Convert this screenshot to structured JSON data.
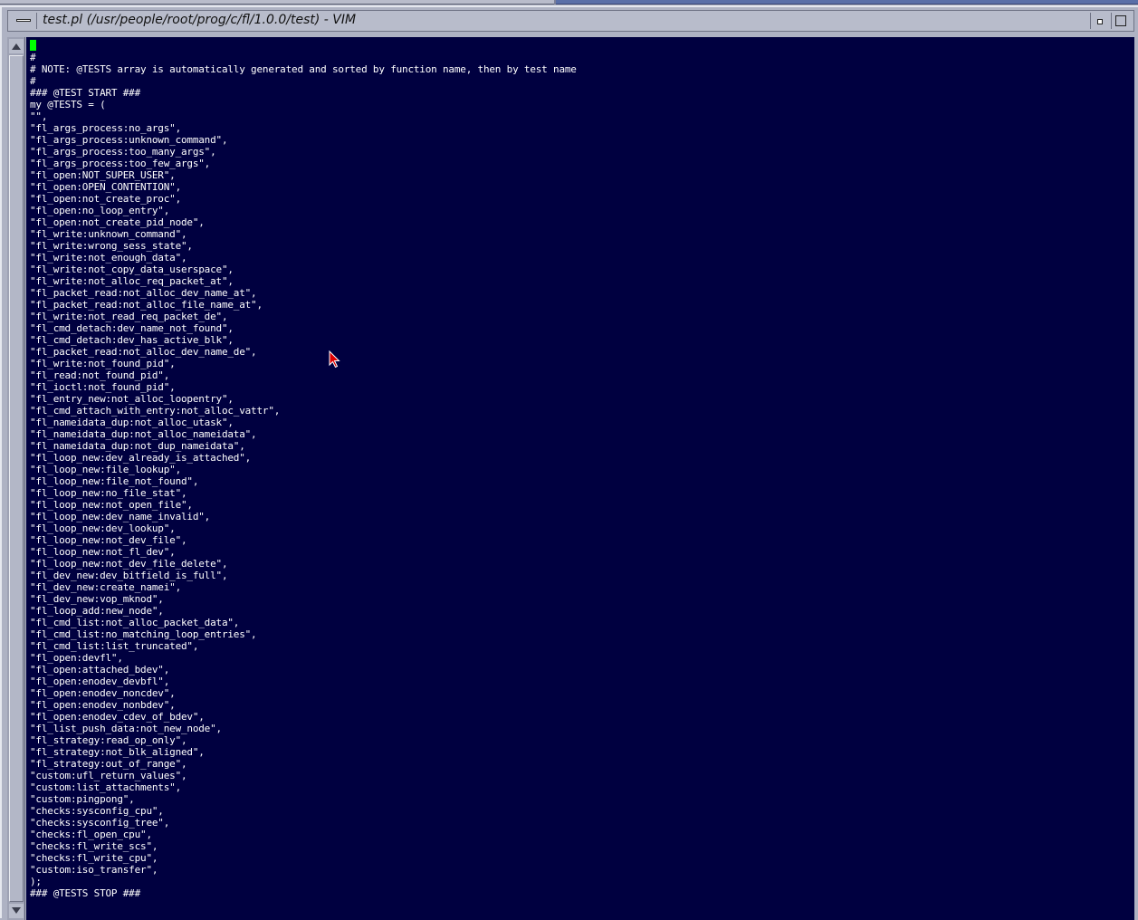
{
  "window": {
    "title": "test.pl (/usr/people/root/prog/c/fl/1.0.0/test) - VIM"
  },
  "editor": {
    "lines": [
      "",
      "#",
      "# NOTE: @TESTS array is automatically generated and sorted by function name, then by test name",
      "#",
      "### @TEST START ###",
      "my @TESTS = (",
      "\"\",",
      "\"fl_args_process:no_args\",",
      "\"fl_args_process:unknown_command\",",
      "\"fl_args_process:too_many_args\",",
      "\"fl_args_process:too_few_args\",",
      "\"fl_open:NOT_SUPER_USER\",",
      "\"fl_open:OPEN_CONTENTION\",",
      "\"fl_open:not_create_proc\",",
      "\"fl_open:no_loop_entry\",",
      "\"fl_open:not_create_pid_node\",",
      "\"fl_write:unknown_command\",",
      "\"fl_write:wrong_sess_state\",",
      "\"fl_write:not_enough_data\",",
      "\"fl_write:not_copy_data_userspace\",",
      "\"fl_write:not_alloc_req_packet_at\",",
      "\"fl_packet_read:not_alloc_dev_name_at\",",
      "\"fl_packet_read:not_alloc_file_name_at\",",
      "\"fl_write:not_read_req_packet_de\",",
      "\"fl_cmd_detach:dev_name_not_found\",",
      "\"fl_cmd_detach:dev_has_active_blk\",",
      "\"fl_packet_read:not_alloc_dev_name_de\",",
      "\"fl_write:not_found_pid\",",
      "\"fl_read:not_found_pid\",",
      "\"fl_ioctl:not_found_pid\",",
      "\"fl_entry_new:not_alloc_loopentry\",",
      "\"fl_cmd_attach_with_entry:not_alloc_vattr\",",
      "\"fl_nameidata_dup:not_alloc_utask\",",
      "\"fl_nameidata_dup:not_alloc_nameidata\",",
      "\"fl_nameidata_dup:not_dup_nameidata\",",
      "\"fl_loop_new:dev_already_is_attached\",",
      "\"fl_loop_new:file_lookup\",",
      "\"fl_loop_new:file_not_found\",",
      "\"fl_loop_new:no_file_stat\",",
      "\"fl_loop_new:not_open_file\",",
      "\"fl_loop_new:dev_name_invalid\",",
      "\"fl_loop_new:dev_lookup\",",
      "\"fl_loop_new:not_dev_file\",",
      "\"fl_loop_new:not_fl_dev\",",
      "\"fl_loop_new:not_dev_file_delete\",",
      "\"fl_dev_new:dev_bitfield_is_full\",",
      "\"fl_dev_new:create_namei\",",
      "\"fl_dev_new:vop_mknod\",",
      "\"fl_loop_add:new_node\",",
      "\"fl_cmd_list:not_alloc_packet_data\",",
      "\"fl_cmd_list:no_matching_loop_entries\",",
      "\"fl_cmd_list:list_truncated\",",
      "\"fl_open:devfl\",",
      "\"fl_open:attached_bdev\",",
      "\"fl_open:enodev_devbfl\",",
      "\"fl_open:enodev_noncdev\",",
      "\"fl_open:enodev_nonbdev\",",
      "\"fl_open:enodev_cdev_of_bdev\",",
      "\"fl_list_push_data:not_new_node\",",
      "\"fl_strategy:read_op_only\",",
      "\"fl_strategy:not_blk_aligned\",",
      "\"fl_strategy:out_of_range\",",
      "\"custom:ufl_return_values\",",
      "\"custom:list_attachments\",",
      "\"custom:pingpong\",",
      "\"checks:sysconfig_cpu\",",
      "\"checks:sysconfig_tree\",",
      "\"checks:fl_open_cpu\",",
      "\"checks:fl_write_scs\",",
      "\"checks:fl_write_cpu\",",
      "\"custom:iso_transfer\",",
      ");",
      "### @TESTS STOP ###"
    ]
  },
  "colors": {
    "editor_bg": "#000040",
    "text": "#ffffff",
    "cursor": "#00ff00",
    "pointer": "#e00000"
  }
}
